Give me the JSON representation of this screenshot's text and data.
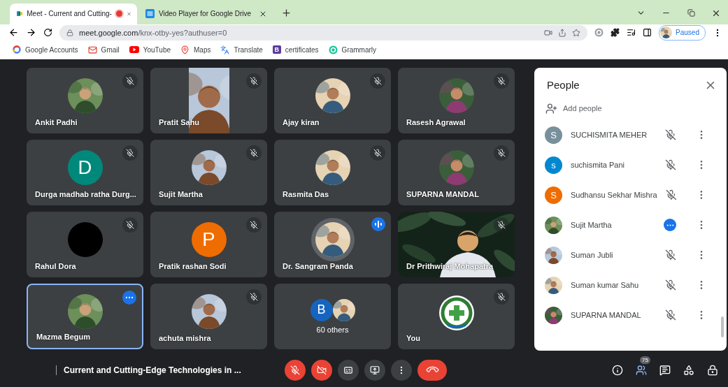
{
  "browser": {
    "tabs": [
      {
        "kind": "meet",
        "title": "Meet - Current and Cutting-",
        "recording": true,
        "selected": true
      },
      {
        "kind": "video_player",
        "title": "Video Player for Google Drive",
        "recording": false,
        "selected": false
      }
    ],
    "url": {
      "host": "meet.google.com",
      "path": "/knx-otby-yes?authuser=0"
    },
    "profile": {
      "label": "Paused"
    },
    "bookmarks": [
      {
        "kind": "google",
        "label": "Google Accounts"
      },
      {
        "kind": "gmail",
        "label": "Gmail"
      },
      {
        "kind": "youtube",
        "label": "YouTube"
      },
      {
        "kind": "maps",
        "label": "Maps"
      },
      {
        "kind": "translate",
        "label": "Translate"
      },
      {
        "kind": "letter",
        "badge": "B",
        "label": "certificates"
      },
      {
        "kind": "grammarly",
        "label": "Grammarly"
      }
    ]
  },
  "tiles": [
    {
      "name": "Ankit Padhi",
      "muted": true,
      "speaking": false,
      "hovered": false
    },
    {
      "name": "Pratit Sahu",
      "kind": "portrait_video",
      "muted": true,
      "speaking": false,
      "hovered": false
    },
    {
      "name": "Ajay kiran",
      "muted": true,
      "speaking": false,
      "hovered": false
    },
    {
      "name": "Rasesh Agrawal",
      "muted": true,
      "speaking": false,
      "hovered": false
    },
    {
      "name": "Durga madhab ratha Durg...",
      "kind": "letter",
      "initial": "D",
      "color": "#00897b",
      "muted": true,
      "speaking": false,
      "hovered": false
    },
    {
      "name": "Sujit Martha",
      "muted": true,
      "speaking": false,
      "hovered": false
    },
    {
      "name": "Rasmita Das",
      "muted": true,
      "speaking": false,
      "hovered": false
    },
    {
      "name": "SUPARNA MANDAL",
      "muted": true,
      "speaking": false,
      "hovered": false
    },
    {
      "name": "Rahul Dora",
      "kind": "blank",
      "color": "#000000",
      "muted": true,
      "speaking": false,
      "hovered": false
    },
    {
      "name": "Pratik rashan Sodi",
      "kind": "letter",
      "initial": "P",
      "color": "#ef6c00",
      "muted": true,
      "speaking": false,
      "hovered": false
    },
    {
      "name": "Dr. Sangram Panda",
      "muted": false,
      "speaking": true,
      "hovered": false
    },
    {
      "name": "Dr Prithwiraj Mohapatra",
      "kind": "video",
      "muted": true,
      "speaking": false,
      "hovered": false
    },
    {
      "name": "Mazma Begum",
      "muted": false,
      "speaking": false,
      "hovered": true
    },
    {
      "name": "achuta mishra",
      "muted": true,
      "speaking": false,
      "hovered": false
    },
    {
      "name": "60 others",
      "kind": "others",
      "initial": "B",
      "color": "#1565c0",
      "muted": false,
      "speaking": false,
      "hovered": false
    },
    {
      "name": "You",
      "kind": "logo",
      "muted": true,
      "speaking": false,
      "hovered": false
    }
  ],
  "people_panel": {
    "title": "People",
    "add_label": "Add people",
    "participants": [
      {
        "name": "SUCHISMITA MEHER",
        "kind": "letter",
        "initial": "S",
        "color": "#78909c",
        "muted": true,
        "hovered": false
      },
      {
        "name": "suchismita Pani",
        "kind": "letter",
        "initial": "s",
        "color": "#0288d1",
        "muted": true,
        "hovered": false
      },
      {
        "name": "Sudhansu Sekhar Mishra",
        "kind": "letter",
        "initial": "S",
        "color": "#ef6c00",
        "muted": true,
        "hovered": false
      },
      {
        "name": "Sujit Martha",
        "muted": false,
        "hovered": true
      },
      {
        "name": "Suman Jubli",
        "muted": true,
        "hovered": false
      },
      {
        "name": "Suman kumar Sahu",
        "muted": true,
        "hovered": false
      },
      {
        "name": "SUPARNA MANDAL",
        "muted": true,
        "hovered": false
      }
    ]
  },
  "bottom_bar": {
    "meeting_title": "Current and Cutting-Edge Technologies in ...",
    "participant_count": "75"
  }
}
